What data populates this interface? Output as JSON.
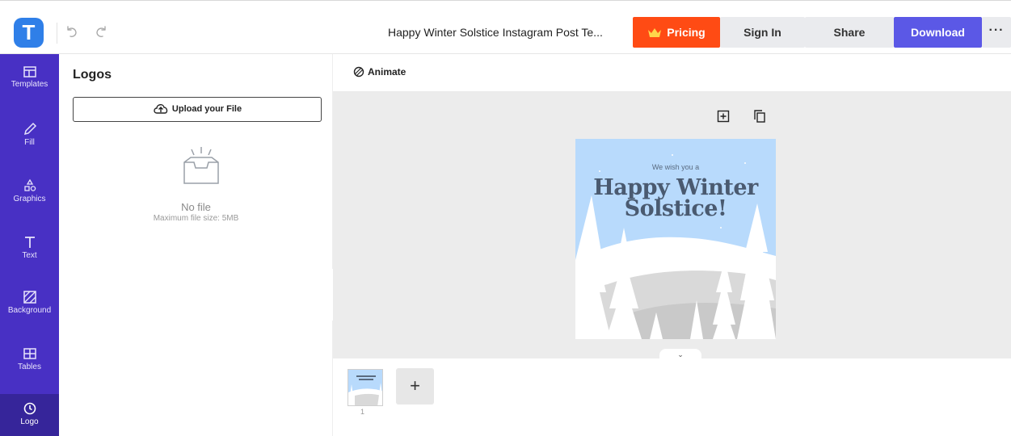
{
  "header": {
    "logo_letter": "T",
    "document_title": "Happy Winter Solstice Instagram Post Te...",
    "buttons": {
      "pricing": "Pricing",
      "sign_in": "Sign In",
      "share": "Share",
      "download": "Download",
      "more": "···"
    }
  },
  "sidebar": {
    "items": [
      {
        "label": "Templates",
        "icon": "templates-icon"
      },
      {
        "label": "Fill",
        "icon": "pencil-icon"
      },
      {
        "label": "Graphics",
        "icon": "shapes-icon"
      },
      {
        "label": "Text",
        "icon": "text-icon"
      },
      {
        "label": "Background",
        "icon": "background-icon"
      },
      {
        "label": "Tables",
        "icon": "table-icon"
      },
      {
        "label": "Logo",
        "icon": "logo-icon"
      }
    ],
    "active": "Logo"
  },
  "panel": {
    "title": "Logos",
    "upload_label": "Upload your File",
    "empty_text": "No file",
    "max_size_text": "Maximum file size: 5MB"
  },
  "toolbar": {
    "animate_label": "Animate"
  },
  "poster": {
    "subtitle": "We wish you a",
    "title_line1": "Happy Winter",
    "title_line2": "Solstice!"
  },
  "pages": {
    "page_number": "1",
    "add_label": "+"
  },
  "colors": {
    "accent": "#5b58e6",
    "pricing": "#ff4b14",
    "sidebar": "#4830c4",
    "sky": "#b8dafc"
  }
}
